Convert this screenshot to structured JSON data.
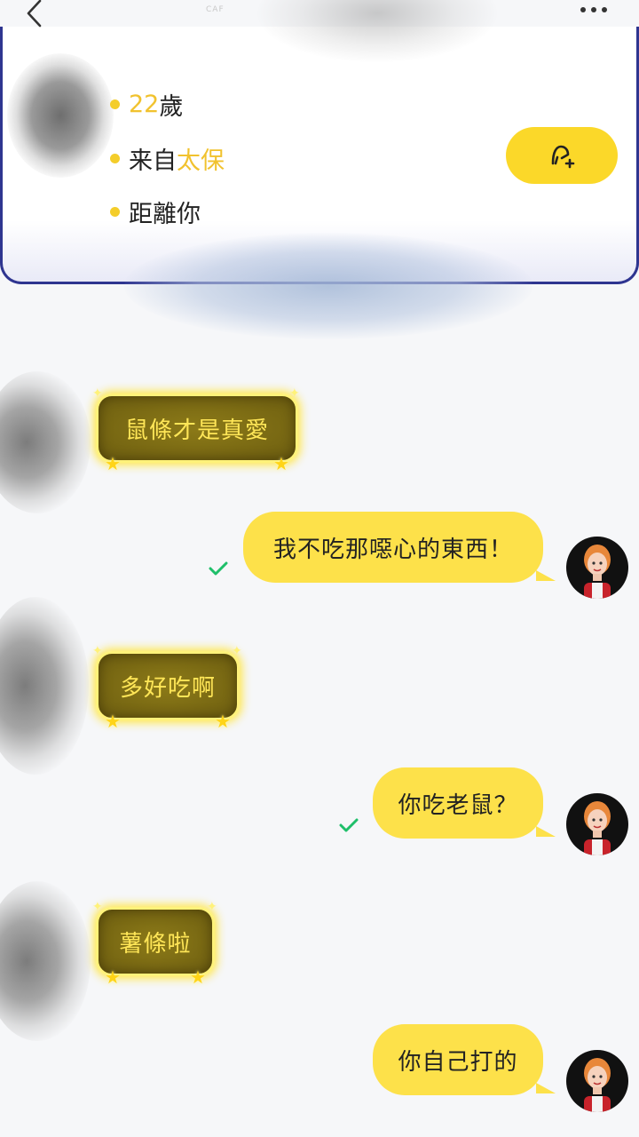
{
  "header": {
    "tiny_text": "CAF"
  },
  "profile": {
    "age_value": "22",
    "age_unit": "歲",
    "from_prefix": "来自",
    "from_place": "太保",
    "distance_label": "距離你"
  },
  "messages": [
    {
      "side": "incoming",
      "text": "鼠條才是真愛"
    },
    {
      "side": "outgoing",
      "text": "我不吃那噁心的東西！",
      "read": true
    },
    {
      "side": "incoming",
      "text": "多好吃啊"
    },
    {
      "side": "outgoing",
      "text": "你吃老鼠？",
      "read": true
    },
    {
      "side": "incoming",
      "text": "薯條啦"
    },
    {
      "side": "outgoing",
      "text": "你自己打的",
      "read": false
    }
  ],
  "colors": {
    "accent_yellow": "#fde14a",
    "highlight": "#f1c22e",
    "card_border": "#2e3590",
    "read_check": "#1fbf6a"
  },
  "icons": {
    "back": "chevron-left",
    "more": "three-dots",
    "add_friend": "person-plus",
    "read": "checkmark"
  }
}
